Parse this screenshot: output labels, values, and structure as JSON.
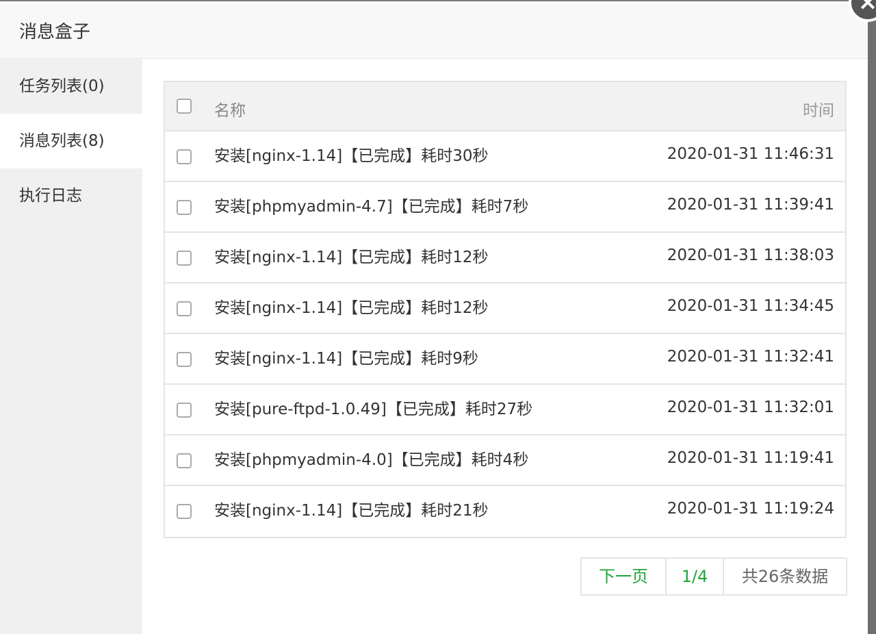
{
  "dialog": {
    "title": "消息盒子",
    "close_icon": "×"
  },
  "sidebar": {
    "items": [
      {
        "label": "任务列表(0)",
        "active": false
      },
      {
        "label": "消息列表(8)",
        "active": true
      },
      {
        "label": "执行日志",
        "active": false
      }
    ]
  },
  "table": {
    "header": {
      "name": "名称",
      "time": "时间"
    },
    "rows": [
      {
        "name": "安装[nginx-1.14]【已完成】耗时30秒",
        "time": "2020-01-31 11:46:31"
      },
      {
        "name": "安装[phpmyadmin-4.7]【已完成】耗时7秒",
        "time": "2020-01-31 11:39:41"
      },
      {
        "name": "安装[nginx-1.14]【已完成】耗时12秒",
        "time": "2020-01-31 11:38:03"
      },
      {
        "name": "安装[nginx-1.14]【已完成】耗时12秒",
        "time": "2020-01-31 11:34:45"
      },
      {
        "name": "安装[nginx-1.14]【已完成】耗时9秒",
        "time": "2020-01-31 11:32:41"
      },
      {
        "name": "安装[pure-ftpd-1.0.49]【已完成】耗时27秒",
        "time": "2020-01-31 11:32:01"
      },
      {
        "name": "安装[phpmyadmin-4.0]【已完成】耗时4秒",
        "time": "2020-01-31 11:19:41"
      },
      {
        "name": "安装[nginx-1.14]【已完成】耗时21秒",
        "time": "2020-01-31 11:19:24"
      }
    ]
  },
  "pager": {
    "next_label": "下一页",
    "current": "1/4",
    "total": "共26条数据"
  },
  "colors": {
    "accent": "#20a53a",
    "sidebar_bg": "#f0f0f0",
    "header_bg": "#f2f2f2"
  }
}
